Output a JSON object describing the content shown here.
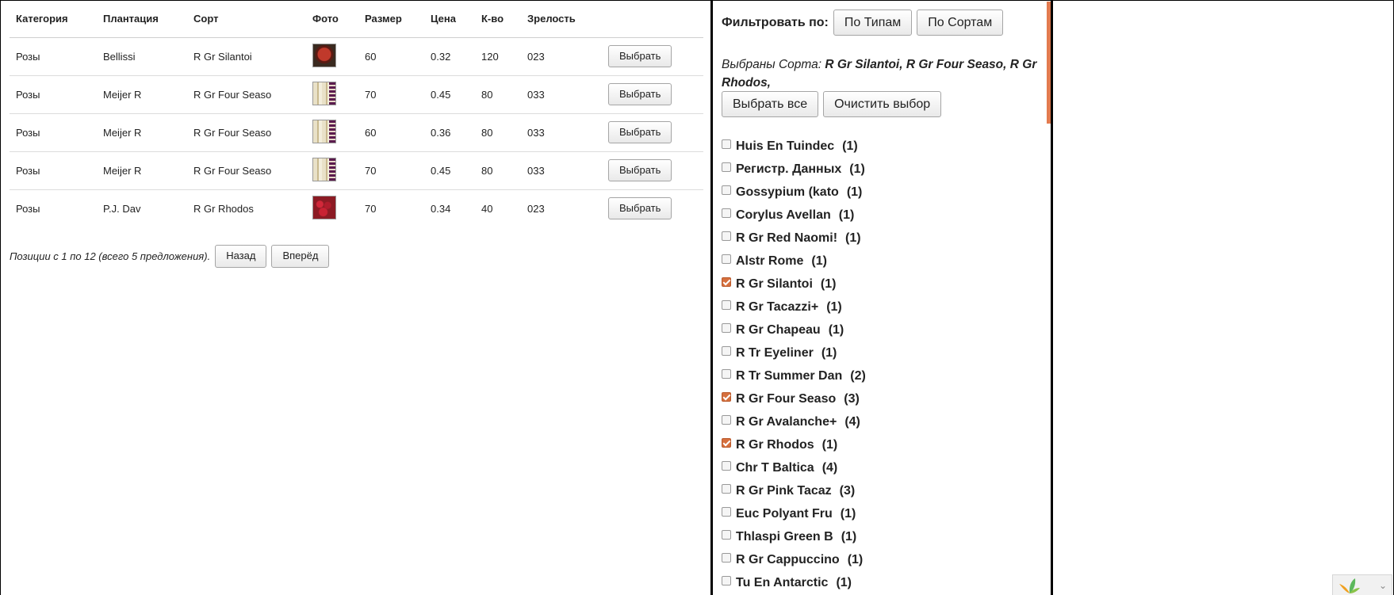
{
  "table": {
    "headers": [
      "Категория",
      "Плантация",
      "Сорт",
      "Фото",
      "Размер",
      "Цена",
      "К-во",
      "Зрелость"
    ],
    "rows": [
      {
        "category": "Розы",
        "plantation": "Bellissi",
        "variety": "R Gr Silantoi",
        "photo": "thumb-a",
        "size": "60",
        "price": "0.32",
        "qty": "120",
        "ripeness": "023",
        "action": "Выбрать"
      },
      {
        "category": "Розы",
        "plantation": "Meijer R",
        "variety": "R Gr Four Seaso",
        "photo": "thumb-b",
        "size": "70",
        "price": "0.45",
        "qty": "80",
        "ripeness": "033",
        "action": "Выбрать"
      },
      {
        "category": "Розы",
        "plantation": "Meijer R",
        "variety": "R Gr Four Seaso",
        "photo": "thumb-b",
        "size": "60",
        "price": "0.36",
        "qty": "80",
        "ripeness": "033",
        "action": "Выбрать"
      },
      {
        "category": "Розы",
        "plantation": "Meijer R",
        "variety": "R Gr Four Seaso",
        "photo": "thumb-b",
        "size": "70",
        "price": "0.45",
        "qty": "80",
        "ripeness": "033",
        "action": "Выбрать"
      },
      {
        "category": "Розы",
        "plantation": "P.J. Dav",
        "variety": "R Gr Rhodos",
        "photo": "thumb-c",
        "size": "70",
        "price": "0.34",
        "qty": "40",
        "ripeness": "023",
        "action": "Выбрать"
      }
    ]
  },
  "pager": {
    "info": "Позиции с 1 по 12 (всего 5 предложения).",
    "back": "Назад",
    "forward": "Вперёд"
  },
  "filter": {
    "label": "Фильтровать по:",
    "by_types": "По Типам",
    "by_varieties": "По Сортам",
    "selected_prefix": "Выбраны Сорта:",
    "selected_values": "R Gr Silantoi, R Gr Four Seaso, R Gr Rhodos,",
    "select_all": "Выбрать все",
    "clear": "Очистить выбор",
    "accent_color": "#e27b4f",
    "check_color": "#d6703e"
  },
  "varieties": [
    {
      "name": "Huis En Tuindec",
      "count": "(1)",
      "checked": false
    },
    {
      "name": "Регистр. Данных",
      "count": "(1)",
      "checked": false
    },
    {
      "name": "Gossypium (kato",
      "count": "(1)",
      "checked": false
    },
    {
      "name": "Corylus Avellan",
      "count": "(1)",
      "checked": false
    },
    {
      "name": "R Gr Red Naomi!",
      "count": "(1)",
      "checked": false
    },
    {
      "name": "Alstr Rome",
      "count": "(1)",
      "checked": false
    },
    {
      "name": "R Gr Silantoi",
      "count": "(1)",
      "checked": true
    },
    {
      "name": "R Gr Tacazzi+",
      "count": "(1)",
      "checked": false
    },
    {
      "name": "R Gr Chapeau",
      "count": "(1)",
      "checked": false
    },
    {
      "name": "R Tr Eyeliner",
      "count": "(1)",
      "checked": false
    },
    {
      "name": "R Tr Summer Dan",
      "count": "(2)",
      "checked": false
    },
    {
      "name": "R Gr Four Seaso",
      "count": "(3)",
      "checked": true
    },
    {
      "name": "R Gr Avalanche+",
      "count": "(4)",
      "checked": false
    },
    {
      "name": "R Gr Rhodos",
      "count": "(1)",
      "checked": true
    },
    {
      "name": "Chr T Baltica",
      "count": "(4)",
      "checked": false
    },
    {
      "name": "R Gr Pink Tacaz",
      "count": "(3)",
      "checked": false
    },
    {
      "name": "Euc Polyant Fru",
      "count": "(1)",
      "checked": false
    },
    {
      "name": "Thlaspi Green B",
      "count": "(1)",
      "checked": false
    },
    {
      "name": "R Gr Cappuccino",
      "count": "(1)",
      "checked": false
    },
    {
      "name": "Tu En Antarctic",
      "count": "(1)",
      "checked": false
    }
  ],
  "icons": {
    "corner_widget": "leaf-icon",
    "corner_chevron": "chevron-down-icon"
  }
}
